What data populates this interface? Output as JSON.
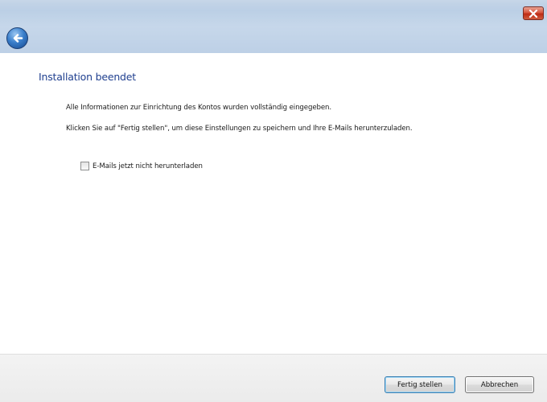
{
  "window": {
    "close_icon": "close-icon",
    "back_icon": "back-arrow-icon"
  },
  "colors": {
    "titlebar": "#bcd0e6",
    "heading": "#1f3f8f",
    "close_red": "#d7553e",
    "back_blue": "#3a7fcb",
    "footer": "#f0f0f0"
  },
  "content": {
    "heading": "Installation beendet",
    "paragraph_1": "Alle Informationen zur Einrichtung des Kontos wurden vollständig eingegeben.",
    "paragraph_2": "Klicken Sie auf \"Fertig stellen\", um diese Einstellungen zu speichern und Ihre E-Mails herunterzuladen.",
    "checkbox": {
      "label": "E-Mails jetzt nicht herunterladen",
      "checked": false
    }
  },
  "footer": {
    "finish_label": "Fertig stellen",
    "cancel_label": "Abbrechen"
  }
}
